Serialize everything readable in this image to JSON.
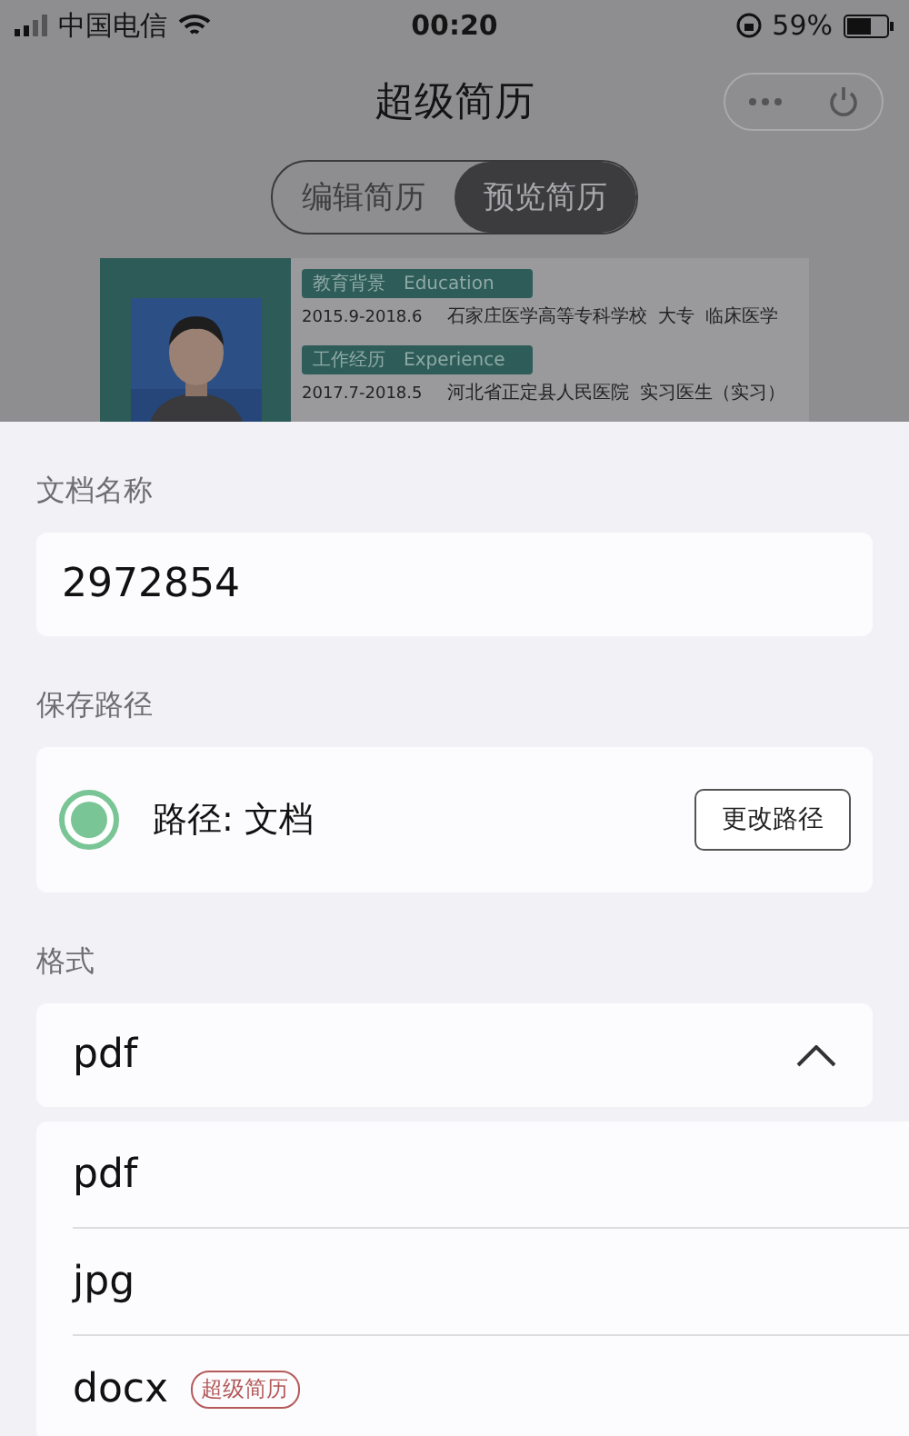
{
  "status_bar": {
    "carrier": "中国电信",
    "time": "00:20",
    "battery": "59%"
  },
  "header": {
    "title": "超级简历"
  },
  "tabs": [
    {
      "label": "编辑简历",
      "selected": false
    },
    {
      "label": "预览简历",
      "selected": true
    }
  ],
  "resume_preview": {
    "sections": [
      {
        "title": "教育背景",
        "subtitle": "Education",
        "rows": [
          [
            "2015.9-2018.6",
            "石家庄医学高等专科学校",
            "大专",
            "临床医学"
          ]
        ]
      },
      {
        "title": "工作经历",
        "subtitle": "Experience",
        "rows": [
          [
            "2017.7-2018.5",
            "河北省正定县人民医院",
            "实习医生（实习）"
          ]
        ]
      }
    ]
  },
  "name_label": "文档名称",
  "name_field": {
    "value": "2972854"
  },
  "path_label": "保存路径",
  "path": {
    "selected": true,
    "text": "路径: 文档",
    "button": "更改路径"
  },
  "format_label": "格式",
  "format_select": {
    "value": "pdf",
    "expanded": true
  },
  "format_options": [
    {
      "label": "pdf"
    },
    {
      "label": "jpg"
    },
    {
      "label": "docx",
      "badge": "超级简历"
    }
  ]
}
